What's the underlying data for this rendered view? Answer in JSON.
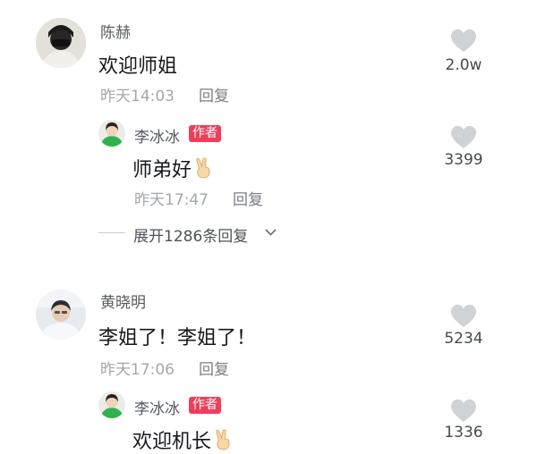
{
  "colors": {
    "author_badge": "#ef3e5c",
    "like_heart": "#cfd2d6",
    "meta_text": "#a3a7ad"
  },
  "comments": [
    {
      "user": "陈赫",
      "text": "欢迎师姐",
      "time": "昨天14:03",
      "reply_label": "回复",
      "likes": "2.0w",
      "reply": {
        "user": "李冰冰",
        "badge": "作者",
        "text": "师弟好",
        "emoji": "victory-hand",
        "time": "昨天17:47",
        "reply_label": "回复",
        "likes": "3399"
      },
      "expand_label": "展开1286条回复"
    },
    {
      "user": "黄晓明",
      "text": "李姐了！李姐了！",
      "time": "昨天17:06",
      "reply_label": "回复",
      "likes": "5234",
      "reply": {
        "user": "李冰冰",
        "badge": "作者",
        "text": "欢迎机长",
        "emoji": "victory-hand",
        "likes": "1336"
      }
    }
  ]
}
